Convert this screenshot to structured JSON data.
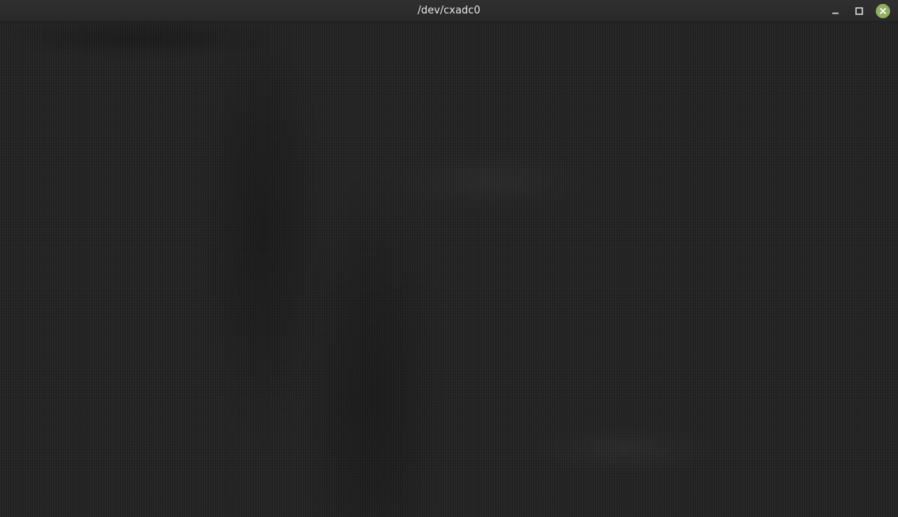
{
  "window": {
    "title": "/dev/cxadc0"
  },
  "icons": {
    "minimize": "minimize-icon",
    "maximize": "maximize-icon",
    "close": "close-icon"
  },
  "colors": {
    "titlebar": "#2c2c2c",
    "title_text": "#e6e6e6",
    "close_button": "#8fb05c",
    "video_background": "#222222"
  }
}
